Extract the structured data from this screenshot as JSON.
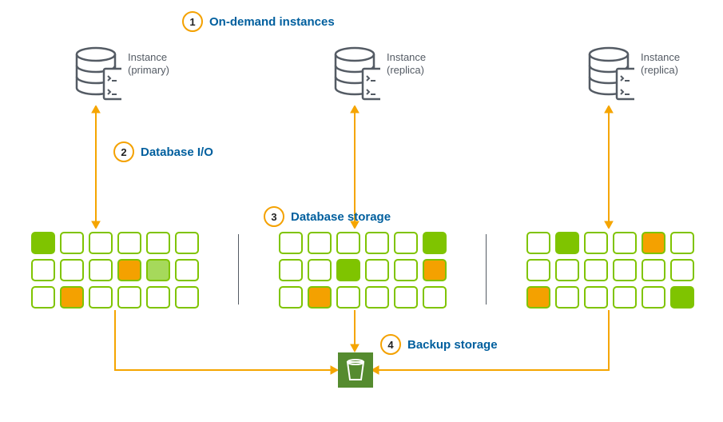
{
  "callouts": {
    "c1": {
      "num": "1",
      "label": "On-demand instances"
    },
    "c2": {
      "num": "2",
      "label": "Database I/O"
    },
    "c3": {
      "num": "3",
      "label": "Database storage"
    },
    "c4": {
      "num": "4",
      "label": "Backup storage"
    }
  },
  "instances": {
    "primary": {
      "line1": "Instance",
      "line2": "(primary)"
    },
    "replica1": {
      "line1": "Instance",
      "line2": "(replica)"
    },
    "replica2": {
      "line1": "Instance",
      "line2": "(replica)"
    }
  },
  "grids": {
    "left": [
      "g",
      "",
      "",
      "",
      "",
      "",
      "",
      "",
      "",
      "o",
      "lg",
      "",
      "",
      "o",
      "",
      "",
      "",
      ""
    ],
    "center": [
      "",
      "",
      "",
      "",
      "",
      "g",
      "",
      "",
      "g",
      "",
      "",
      "o",
      "",
      "o",
      "",
      "",
      "",
      ""
    ],
    "right": [
      "",
      "g",
      "",
      "",
      "o",
      "",
      "",
      "",
      "",
      "",
      "",
      "",
      "o",
      "",
      "",
      "",
      "",
      "g"
    ]
  },
  "colors": {
    "accent_blue": "#005f9e",
    "accent_orange": "#f5a500",
    "accent_green": "#7fc400",
    "bucket_green": "#558b2f"
  }
}
